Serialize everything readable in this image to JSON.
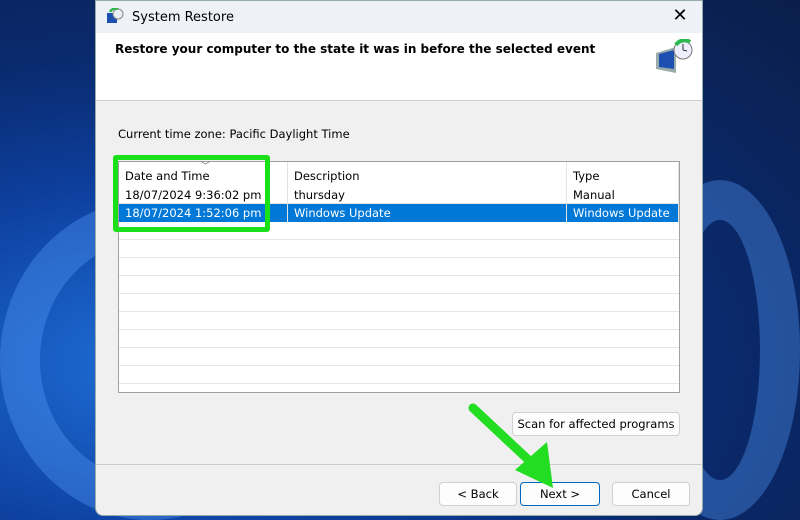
{
  "window": {
    "title": "System Restore"
  },
  "header": {
    "title": "Restore your computer to the state it was in before the selected event"
  },
  "timezone": "Current time zone: Pacific Daylight Time",
  "table": {
    "columns": [
      "Date and Time",
      "Description",
      "Type"
    ],
    "rows": [
      {
        "date": "18/07/2024 9:36:02 pm",
        "description": "thursday",
        "type": "Manual",
        "selected": false
      },
      {
        "date": "18/07/2024 1:52:06 pm",
        "description": "Windows Update",
        "type": "Windows Update",
        "selected": true
      }
    ]
  },
  "buttons": {
    "scan": "Scan for affected programs",
    "back": "< Back",
    "next": "Next >",
    "cancel": "Cancel"
  },
  "colors": {
    "selection": "#0078d7",
    "highlight": "#19e019"
  }
}
